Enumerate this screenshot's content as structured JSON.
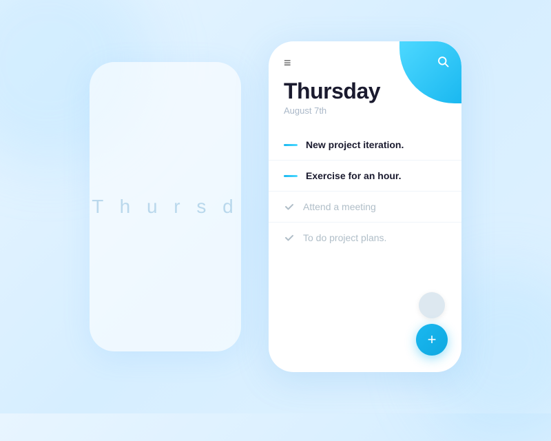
{
  "background": {
    "color": "#daeeff"
  },
  "phone_left": {
    "day_text": "T h u r s d"
  },
  "phone_right": {
    "header": {
      "hamburger_icon": "≡",
      "search_icon": "⌕",
      "day": "Thursday",
      "date": "August 7th"
    },
    "tasks": [
      {
        "id": 1,
        "label": "New project iteration.",
        "status": "active",
        "indicator": "dash"
      },
      {
        "id": 2,
        "label": "Exercise for an hour.",
        "status": "active",
        "indicator": "dash"
      },
      {
        "id": 3,
        "label": "Attend a meeting",
        "status": "done",
        "indicator": "check"
      },
      {
        "id": 4,
        "label": "To do project plans.",
        "status": "done",
        "indicator": "check"
      }
    ],
    "fab_plus_label": "+"
  }
}
